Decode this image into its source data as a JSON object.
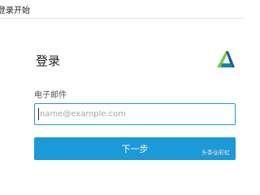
{
  "window": {
    "title": "登录开始"
  },
  "login": {
    "heading": "登录",
    "logo_icon": "autodesk-a-logo-icon",
    "email_label": "电子邮件",
    "email_value": "",
    "email_placeholder": "name@example.com",
    "next_label": "下一步"
  },
  "watermark": {
    "text": "头条@彩虹"
  },
  "colors": {
    "accent": "#1a9ad6",
    "logo_green": "#7ec34a",
    "logo_teal": "#138a9c",
    "logo_blue": "#1d5a8c"
  }
}
